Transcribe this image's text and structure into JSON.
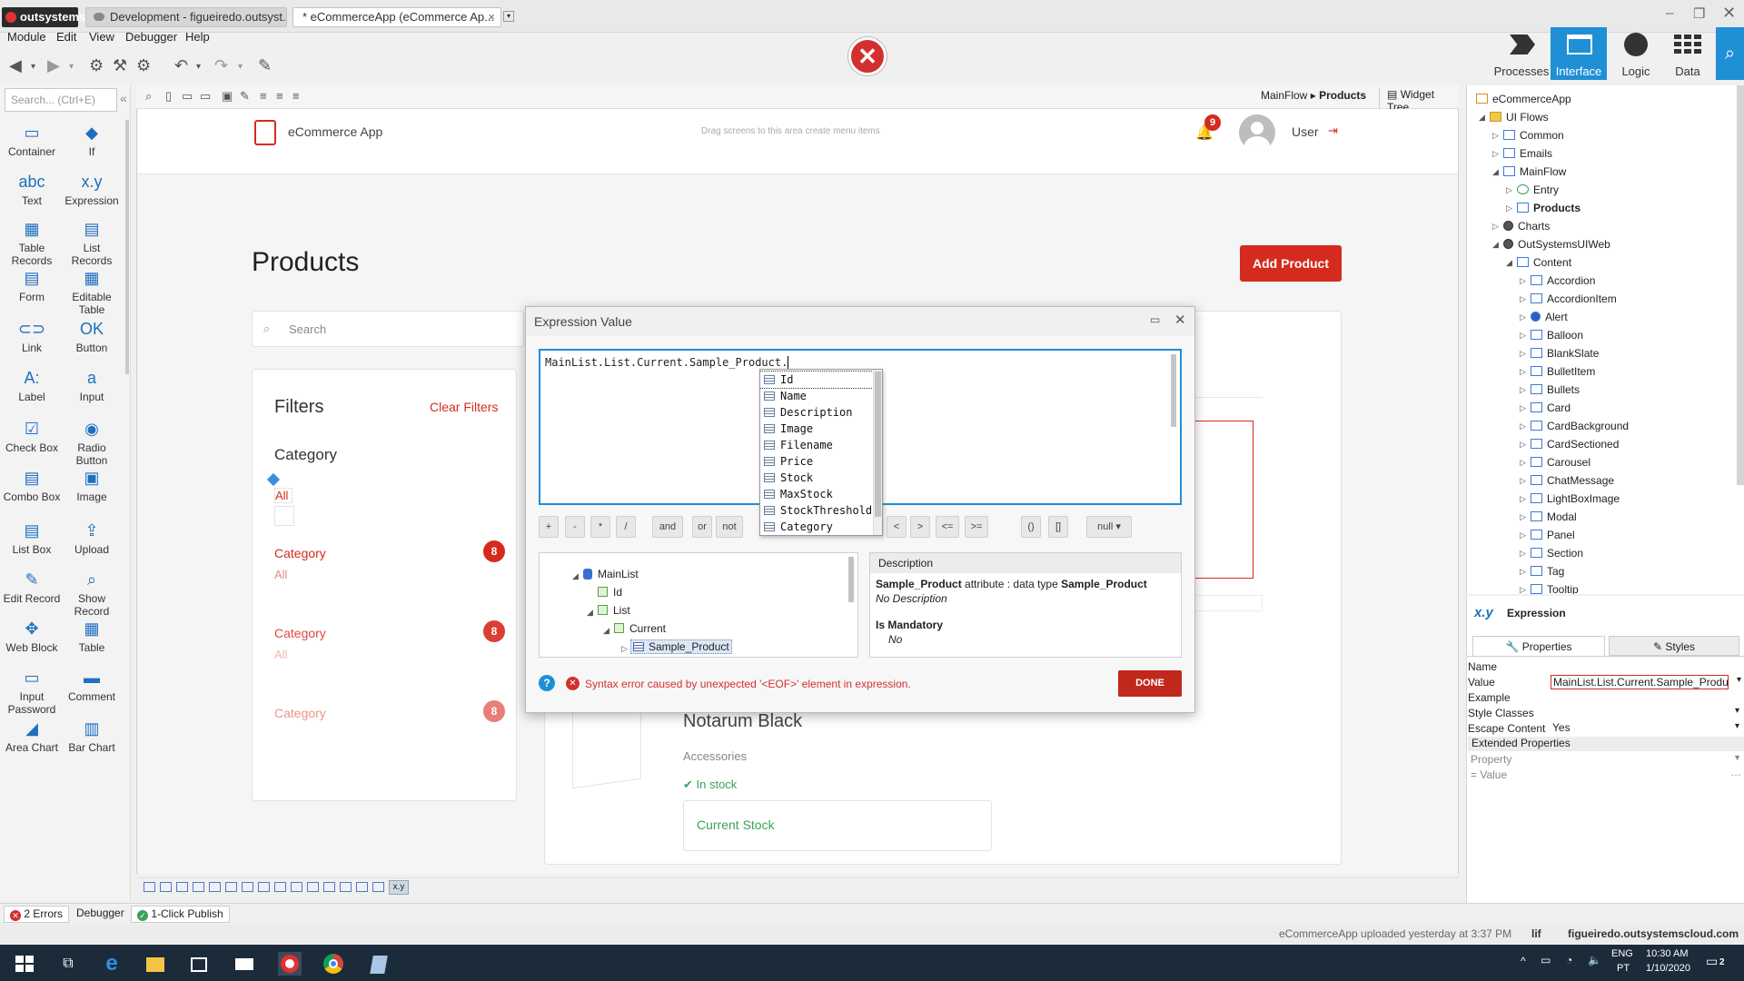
{
  "titlebar": {
    "brand": "outsystems",
    "tabs": [
      {
        "label": "Development - figueiredo.outsyst..."
      },
      {
        "label": "* eCommerceApp (eCommerce Ap..."
      }
    ]
  },
  "menu": [
    "Module",
    "Edit",
    "View",
    "Debugger",
    "Help"
  ],
  "top_tabs": [
    "Processes",
    "Interface",
    "Logic",
    "Data"
  ],
  "palette": {
    "search_placeholder": "Search... (Ctrl+E)",
    "items": [
      {
        "label": "Container",
        "icon": "container-icon"
      },
      {
        "label": "If",
        "icon": "if-icon"
      },
      {
        "label": "Text",
        "icon": "text-icon"
      },
      {
        "label": "Expression",
        "icon": "expression-icon"
      },
      {
        "label": "Table Records",
        "icon": "table-records-icon"
      },
      {
        "label": "List Records",
        "icon": "list-records-icon"
      },
      {
        "label": "Form",
        "icon": "form-icon"
      },
      {
        "label": "Editable Table",
        "icon": "editable-table-icon"
      },
      {
        "label": "Link",
        "icon": "link-icon"
      },
      {
        "label": "Button",
        "icon": "button-icon"
      },
      {
        "label": "Label",
        "icon": "label-icon"
      },
      {
        "label": "Input",
        "icon": "input-icon"
      },
      {
        "label": "Check Box",
        "icon": "checkbox-icon"
      },
      {
        "label": "Radio Button",
        "icon": "radio-icon"
      },
      {
        "label": "Combo Box",
        "icon": "combo-icon"
      },
      {
        "label": "Image",
        "icon": "image-icon"
      },
      {
        "label": "List Box",
        "icon": "listbox-icon"
      },
      {
        "label": "Upload",
        "icon": "upload-icon"
      },
      {
        "label": "Edit Record",
        "icon": "edit-record-icon"
      },
      {
        "label": "Show Record",
        "icon": "show-record-icon"
      },
      {
        "label": "Web Block",
        "icon": "web-block-icon"
      },
      {
        "label": "Table",
        "icon": "table-icon"
      },
      {
        "label": "Input Password",
        "icon": "password-icon"
      },
      {
        "label": "Comment",
        "icon": "comment-icon"
      },
      {
        "label": "Area Chart",
        "icon": "area-chart-icon"
      },
      {
        "label": "Bar Chart",
        "icon": "bar-chart-icon"
      }
    ]
  },
  "breadcrumb": {
    "flow": "MainFlow",
    "sep": "▸",
    "screen": "Products"
  },
  "widget_tree_label": "Widget Tree",
  "app": {
    "title": "eCommerce App",
    "menu_hint": "Drag screens to this area create menu items",
    "notifications": "9",
    "user": "User"
  },
  "page": {
    "heading": "Products",
    "add_button": "Add Product",
    "search_placeholder": "Search",
    "filters_title": "Filters",
    "clear_filters": "Clear Filters",
    "category_heading": "Category",
    "all_label": "All",
    "categories": [
      {
        "label": "Category",
        "sub": "All",
        "count": "8"
      },
      {
        "label": "Category",
        "sub": "All",
        "count": "8"
      },
      {
        "label": "Category",
        "sub": "",
        "count": "8"
      }
    ],
    "product": {
      "name": "Notarum Black",
      "category": "Accessories",
      "stock_status": "In stock",
      "stock_label": "Current Stock"
    }
  },
  "dialog": {
    "title": "Expression Value",
    "expression": "MainList.List.Current.Sample_Product.",
    "autocomplete": [
      "Id",
      "Name",
      "Description",
      "Image",
      "Filename",
      "Price",
      "Stock",
      "MaxStock",
      "StockThreshold",
      "Category"
    ],
    "operators": [
      "+",
      "-",
      "*",
      "/",
      "and",
      "or",
      "not",
      "<>",
      "<",
      ">",
      "<=",
      ">=",
      "()",
      "[]",
      "null"
    ],
    "tree": [
      {
        "label": "MainList"
      },
      {
        "label": "Id"
      },
      {
        "label": "List"
      },
      {
        "label": "Current"
      },
      {
        "label": "Sample_Product"
      }
    ],
    "description_header": "Description",
    "desc_line1_a": "Sample_Product",
    "desc_line1_b": " attribute : data type ",
    "desc_line1_c": "Sample_Product",
    "desc_line2": "No Description",
    "mandatory_label": "Is Mandatory",
    "mandatory_value": "No",
    "error": "Syntax error caused by unexpected '<EOF>' element in expression.",
    "done": "DONE"
  },
  "rtree": [
    {
      "label": "eCommerceApp",
      "level": 0
    },
    {
      "label": "UI Flows",
      "level": 1
    },
    {
      "label": "Common",
      "level": 2
    },
    {
      "label": "Emails",
      "level": 2
    },
    {
      "label": "MainFlow",
      "level": 2
    },
    {
      "label": "Entry",
      "level": 3
    },
    {
      "label": "Products",
      "level": 3
    },
    {
      "label": "Charts",
      "level": 2
    },
    {
      "label": "OutSystemsUIWeb",
      "level": 2
    },
    {
      "label": "Content",
      "level": 3
    },
    {
      "label": "Accordion",
      "level": 4
    },
    {
      "label": "AccordionItem",
      "level": 4
    },
    {
      "label": "Alert",
      "level": 4
    },
    {
      "label": "Balloon",
      "level": 4
    },
    {
      "label": "BlankSlate",
      "level": 4
    },
    {
      "label": "BulletItem",
      "level": 4
    },
    {
      "label": "Bullets",
      "level": 4
    },
    {
      "label": "Card",
      "level": 4
    },
    {
      "label": "CardBackground",
      "level": 4
    },
    {
      "label": "CardSectioned",
      "level": 4
    },
    {
      "label": "Carousel",
      "level": 4
    },
    {
      "label": "ChatMessage",
      "level": 4
    },
    {
      "label": "LightBoxImage",
      "level": 4
    },
    {
      "label": "Modal",
      "level": 4
    },
    {
      "label": "Panel",
      "level": 4
    },
    {
      "label": "Section",
      "level": 4
    },
    {
      "label": "Tag",
      "level": 4
    },
    {
      "label": "Tooltip",
      "level": 4
    }
  ],
  "props": {
    "header": "Expression",
    "tabs": [
      "Properties",
      "Styles"
    ],
    "rows": [
      {
        "k": "Name",
        "v": ""
      },
      {
        "k": "Value",
        "v": "MainList.List.Current.Sample_Produ"
      },
      {
        "k": "Example",
        "v": ""
      },
      {
        "k": "Style Classes",
        "v": ""
      },
      {
        "k": "Escape Content",
        "v": "Yes"
      }
    ],
    "extended": "Extended Properties",
    "property": "Property",
    "value": "= Value"
  },
  "errbar": {
    "errors": "2 Errors",
    "debugger": "Debugger",
    "publish": "1-Click Publish"
  },
  "statusbar": {
    "upload": "eCommerceApp uploaded yesterday at 3:37 PM",
    "lif": "lif",
    "server": "figueiredo.outsystemscloud.com"
  },
  "taskbar": {
    "lang1": "ENG",
    "lang2": "PT",
    "time": "10:30 AM",
    "date": "1/10/2020",
    "notif_count": "2"
  },
  "colors": {
    "accent": "#1f8fd6",
    "brand_red": "#d52b1e"
  }
}
